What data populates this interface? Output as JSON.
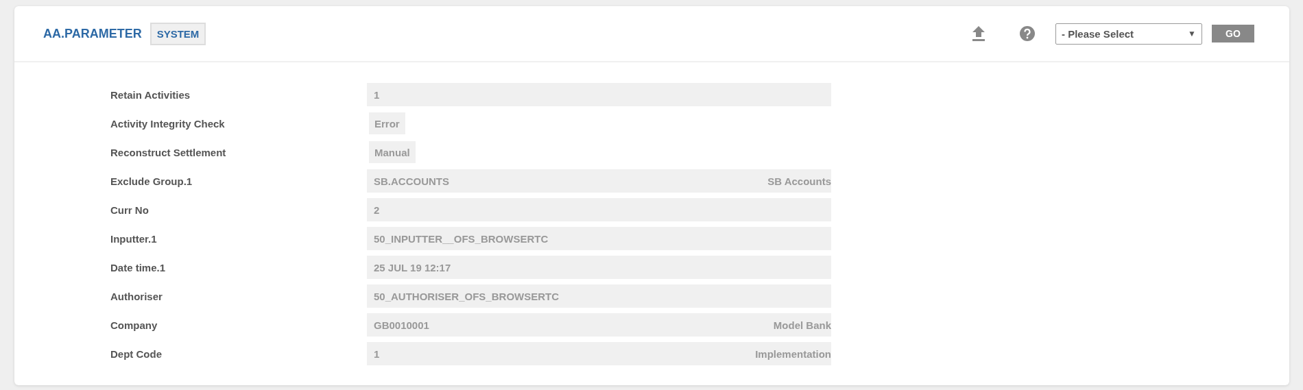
{
  "header": {
    "title": "AA.PARAMETER",
    "badge": "SYSTEM",
    "select": {
      "value": "- Please Select",
      "arrow": "▼"
    },
    "go_button": "GO"
  },
  "fields": [
    {
      "label": "Retain Activities",
      "kind": "full",
      "value": "1"
    },
    {
      "label": "Activity Integrity Check",
      "kind": "short",
      "value": "Error"
    },
    {
      "label": "Reconstruct Settlement",
      "kind": "short",
      "value": "Manual"
    },
    {
      "label": "Exclude Group.1",
      "kind": "full",
      "value": "SB.ACCOUNTS",
      "description": "SB Accounts"
    },
    {
      "label": "Curr No",
      "kind": "full",
      "value": "2"
    },
    {
      "label": "Inputter.1",
      "kind": "full",
      "value": "50_INPUTTER__OFS_BROWSERTC"
    },
    {
      "label": "Date time.1",
      "kind": "full",
      "value": "25 JUL 19 12:17"
    },
    {
      "label": "Authoriser",
      "kind": "full",
      "value": "50_AUTHORISER_OFS_BROWSERTC"
    },
    {
      "label": "Company",
      "kind": "full",
      "value": "GB0010001",
      "description": "Model Bank"
    },
    {
      "label": "Dept Code",
      "kind": "full",
      "value": "1",
      "description": "Implementation"
    }
  ]
}
